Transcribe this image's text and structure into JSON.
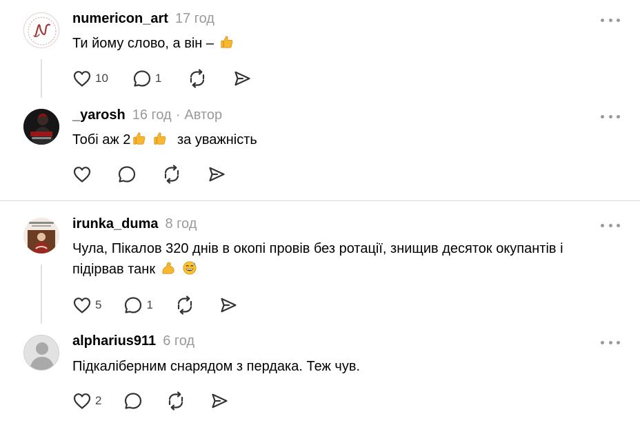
{
  "comments": [
    {
      "username": "numericon_art",
      "time": "17 год",
      "text": "Ти йому слово, а він –",
      "likes": "10",
      "replies": "1",
      "avatar_icon": "script-n-logo-icon"
    },
    {
      "username": "_yarosh",
      "time": "16 год",
      "separator": "·",
      "author_badge": "Автор",
      "text_prefix": "Тобі аж 2",
      "text_suffix": "за уважність",
      "likes": "",
      "replies": ""
    },
    {
      "username": "irunka_duma",
      "time": "8 год",
      "text_line1": "Чула, Пікалов 320 днів в окопі провів без ротації, знищив десяток окупантів і",
      "text_line2": "підірвав танк",
      "likes": "5",
      "replies": "1"
    },
    {
      "username": "alpharius911",
      "time": "6 год",
      "text": "Підкаліберним снарядом з пердака. Теж чув.",
      "likes": "2",
      "replies": ""
    }
  ],
  "colors": {
    "text": "#000000",
    "muted": "#999999",
    "thread_line": "#e0e0e0",
    "emoji_yellow": "#f7b731"
  },
  "icons": {
    "like": "heart-outline-icon",
    "reply": "speech-bubble-icon",
    "repost": "repost-arrows-icon",
    "share": "paper-plane-icon",
    "more": "more-dots-icon",
    "thumbs_up": "thumbs-up-emoji",
    "flexed_biceps": "flexed-biceps-emoji",
    "grinning_sweat": "grinning-sweat-emoji"
  }
}
